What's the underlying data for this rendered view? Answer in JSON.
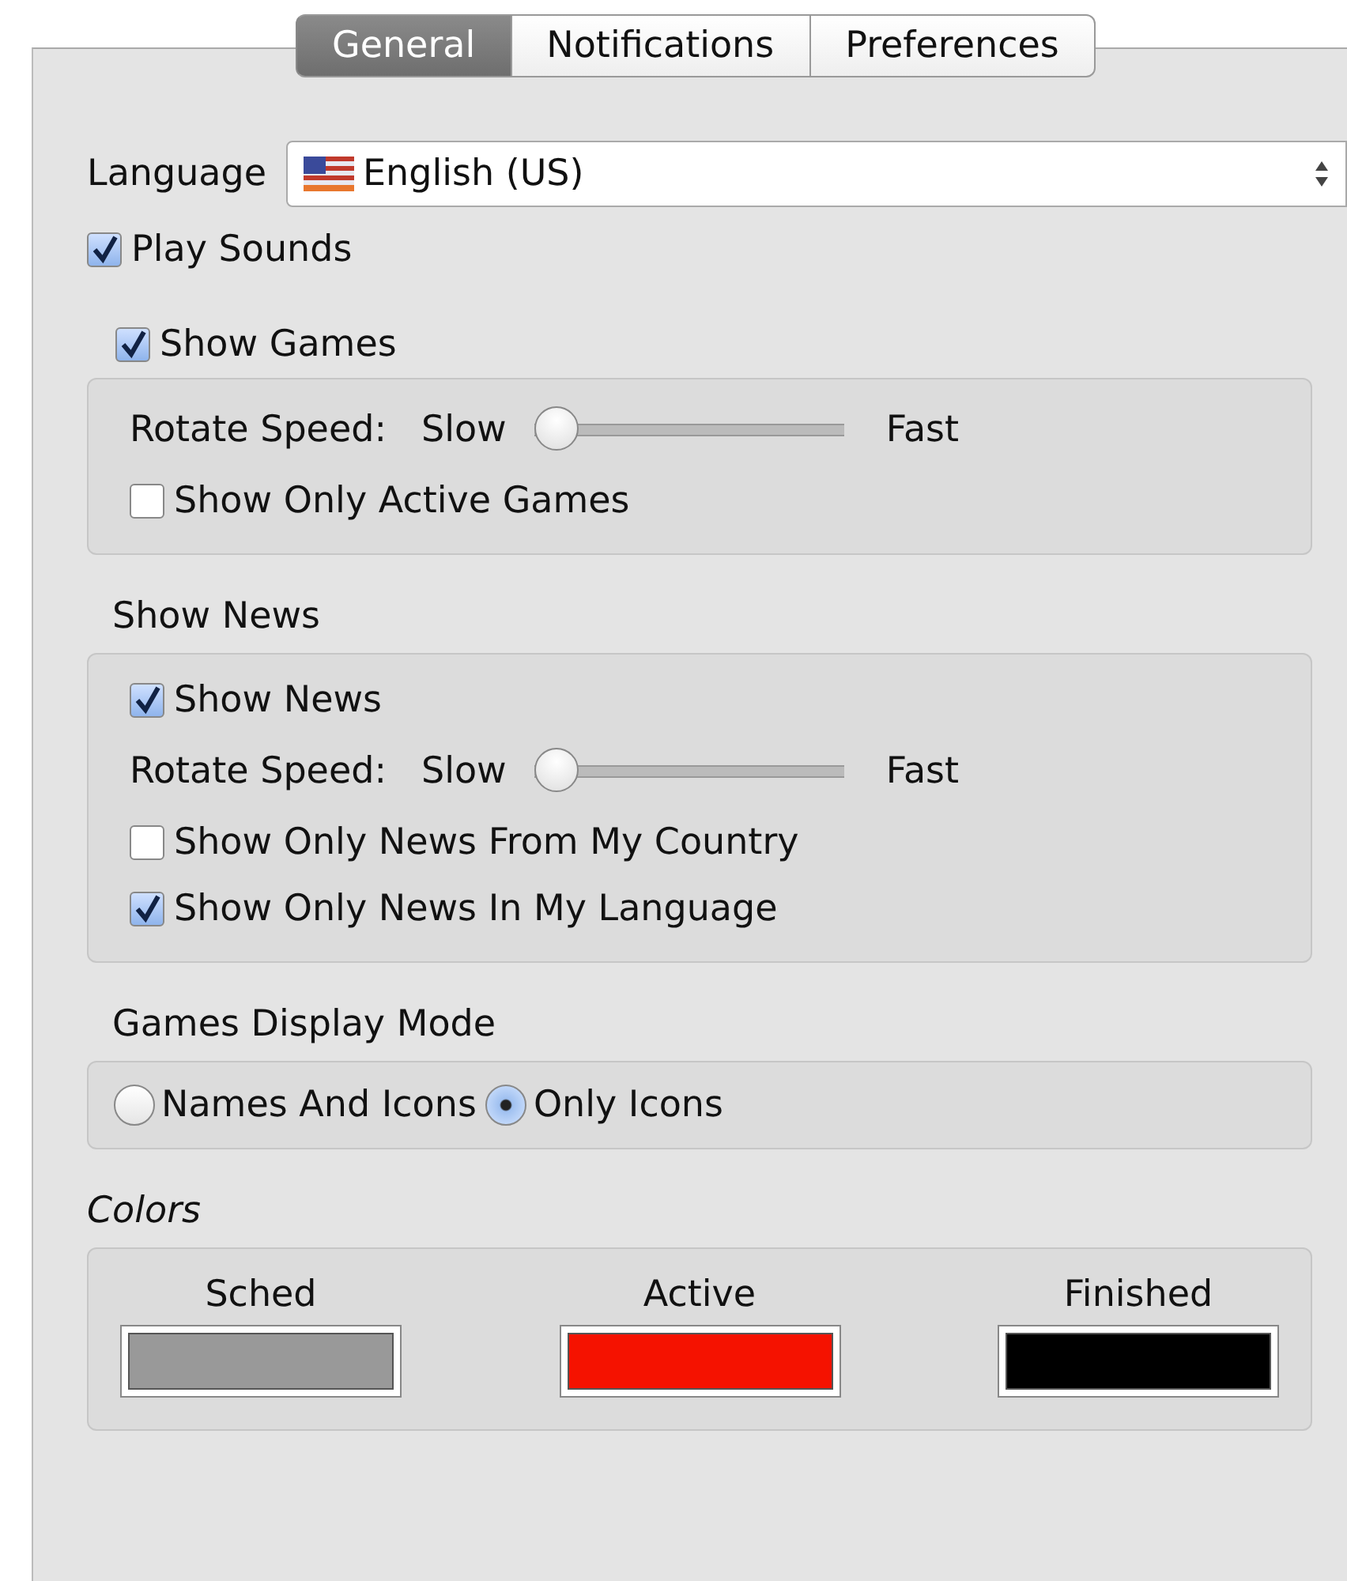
{
  "tabs": [
    {
      "label": "General",
      "selected": true
    },
    {
      "label": "Notifications",
      "selected": false
    },
    {
      "label": "Preferences",
      "selected": false
    }
  ],
  "language": {
    "label": "Language",
    "value": "English (US)"
  },
  "play_sounds": {
    "label": "Play Sounds",
    "checked": true
  },
  "show_games": {
    "label": "Show Games",
    "checked": true
  },
  "games_box": {
    "rotate_label": "Rotate Speed:",
    "slow": "Slow",
    "fast": "Fast",
    "level": 0,
    "checks": [
      {
        "label": "Show Only Active Games",
        "checked": false
      }
    ]
  },
  "news_title": "Show News",
  "news_box": {
    "show_news": {
      "label": "Show News",
      "checked": true
    },
    "rotate_label": "Rotate Speed:",
    "slow": "Slow",
    "fast": "Fast",
    "level": 0,
    "checks": [
      {
        "label": "Show Only News From My Country",
        "checked": false
      },
      {
        "label": "Show Only News In My Language",
        "checked": true
      }
    ]
  },
  "display_mode": {
    "title": "Games Display Mode",
    "options": [
      {
        "label": "Names And Icons",
        "selected": false
      },
      {
        "label": "Only Icons",
        "selected": true
      }
    ]
  },
  "colors": {
    "title": "Colors",
    "swatches": [
      {
        "label": "Sched",
        "color": "#999999"
      },
      {
        "label": "Active",
        "color": "#f51200"
      },
      {
        "label": "Finished",
        "color": "#000000"
      }
    ]
  }
}
